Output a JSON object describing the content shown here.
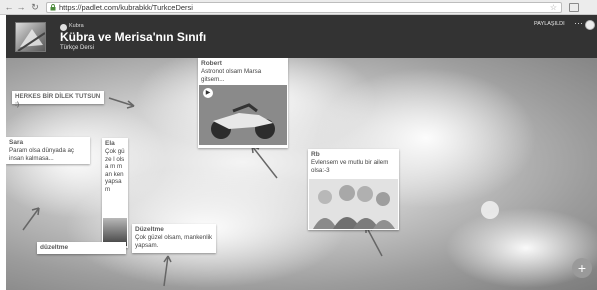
{
  "browser": {
    "url": "https://padlet.com/kubrabkk/TurkceDersi"
  },
  "header": {
    "author": "Kubra",
    "title": "Kübra ve Merisa'nın Sınıfı",
    "description": "Türkçe Dersi",
    "share_label": "PAYLAŞILDI",
    "more_label": "···"
  },
  "posts": {
    "wish": {
      "title": "HERKES BİR DİLEK TUTSUN :)"
    },
    "robert": {
      "author": "Robert",
      "body": "Astronot olsam Marsa gitsem..."
    },
    "sara": {
      "author": "Sara",
      "body": "Param olsa dünyada aç insan kalmasa..."
    },
    "ela": {
      "author": "Ela",
      "body": "Çok güze l olsa m man ken yapsam"
    },
    "rb": {
      "author": "Rb",
      "body": "Evlensem ve mutlu bir ailem olsa:-3"
    },
    "duzeltme1": {
      "author": "düzeltme"
    },
    "duzeltme2": {
      "author": "Düzeltme",
      "body": "Çok güzel olsam, mankenlik yapsam."
    }
  },
  "fab_label": "+"
}
